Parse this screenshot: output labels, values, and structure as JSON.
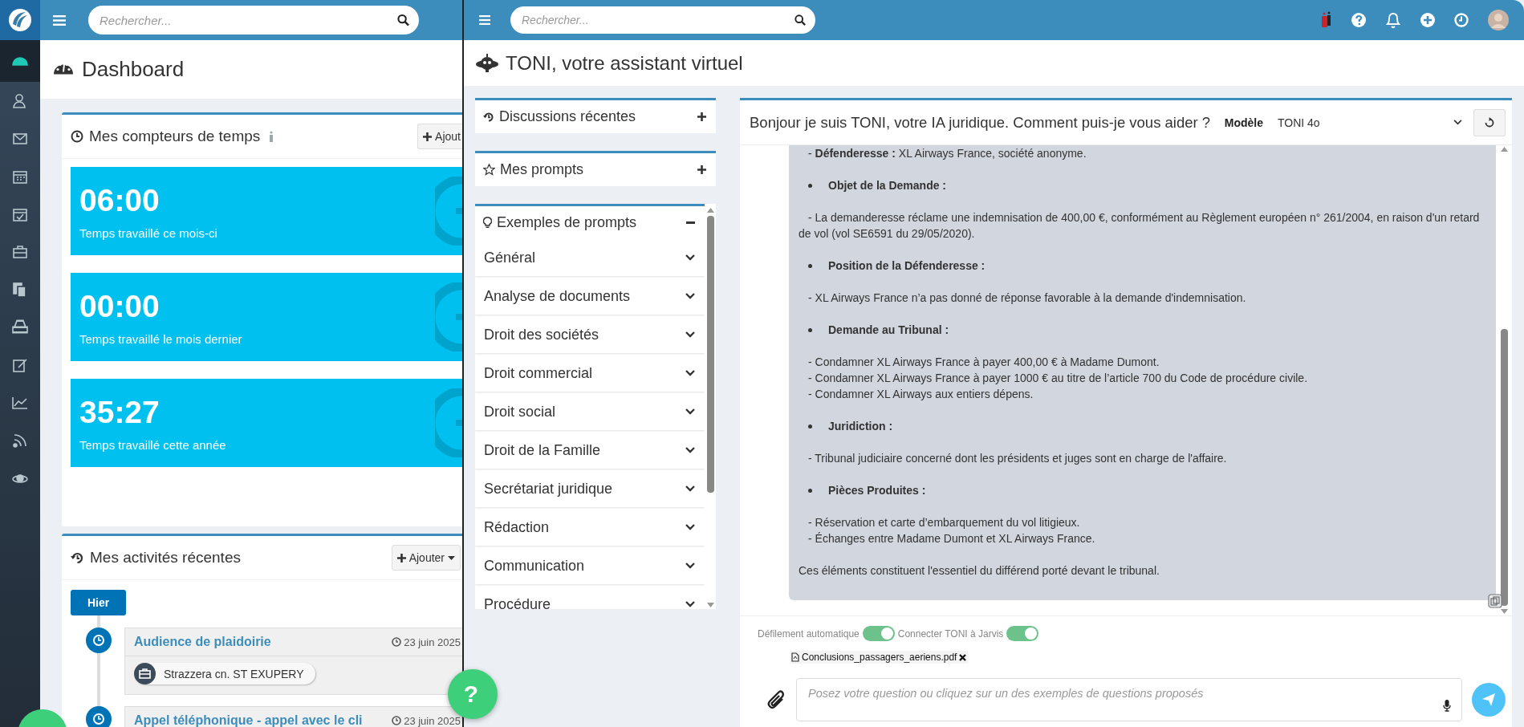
{
  "app_bar": {
    "search": {
      "placeholder": "Rechercher..."
    }
  },
  "sidebar": {
    "items": [
      {
        "selected": true
      },
      {
        "selected": false
      },
      {
        "selected": false
      },
      {
        "selected": false
      },
      {
        "selected": false
      },
      {
        "selected": false
      },
      {
        "selected": false
      },
      {
        "selected": false
      },
      {
        "selected": false
      },
      {
        "selected": false
      },
      {
        "selected": false
      },
      {
        "selected": false
      }
    ]
  },
  "dashboard": {
    "title": "Dashboard",
    "counters_card": {
      "title": "Mes compteurs de temps",
      "add_button": "Ajout",
      "counters": [
        {
          "value": "06:00",
          "label": "Temps travaillé ce mois-ci"
        },
        {
          "value": "00:00",
          "label": "Temps travaillé le mois dernier"
        },
        {
          "value": "35:27",
          "label": "Temps travaillé cette année"
        }
      ]
    },
    "activities_card": {
      "title": "Mes activités récentes",
      "add_button": "Ajouter",
      "groups": [
        {
          "label": "Hier",
          "items": [
            {
              "title": "Audience de plaidoirie",
              "date": "23 juin 2025",
              "tags": [
                "Strazzera cn. ST EXUPERY"
              ]
            },
            {
              "title": "Appel téléphonique - appel avec le cli",
              "date": "23 juin 2025"
            }
          ]
        }
      ]
    }
  },
  "help_button": {
    "label": "?"
  },
  "assistant": {
    "top_bar": {
      "search": {
        "placeholder": "Rechercher..."
      }
    },
    "title": "TONI, votre assistant virtuel",
    "sections": [
      {
        "title": "Discussions récentes",
        "expanded": false
      },
      {
        "title": "Mes prompts",
        "expanded": false
      },
      {
        "title": "Exemples de prompts",
        "expanded": true,
        "items": [
          "Général",
          "Analyse de documents",
          "Droit des sociétés",
          "Droit commercial",
          "Droit social",
          "Droit de la Famille",
          "Secrétariat juridique",
          "Rédaction",
          "Communication",
          "Procédure"
        ]
      }
    ],
    "chat": {
      "greeting": "Bonjour je suis TONI, votre IA juridique. Comment puis-je vous aider ?",
      "model_label": "Modèle",
      "model": "TONI 4o",
      "message": [
        {
          "kind": "text",
          "lines": [
            "- **Défenderesse :** XL Airways France, société anonyme."
          ]
        },
        {
          "kind": "bullet",
          "lines": [
            "Objet de la Demande :"
          ]
        },
        {
          "kind": "text",
          "lines": [
            "- La demanderesse réclame une indemnisation de 400,00 €, conformément au Règlement européen n° 261/2004, en raison d'un retard de vol (vol SE6591 du 29/05/2020)."
          ]
        },
        {
          "kind": "bullet",
          "lines": [
            "Position de la Défenderesse :"
          ]
        },
        {
          "kind": "text",
          "lines": [
            "- XL Airways France n’a pas donné de réponse favorable à la demande d'indemnisation."
          ]
        },
        {
          "kind": "bullet",
          "lines": [
            "Demande au Tribunal :"
          ]
        },
        {
          "kind": "text",
          "lines": [
            "- Condamner XL Airways France à payer 400,00 € à Madame Dumont.",
            "- Condamner XL Airways France à payer 1000 € au titre de l’article 700 du Code de procédure civile.",
            "- Condamner XL Airways aux entiers dépens."
          ]
        },
        {
          "kind": "bullet",
          "lines": [
            "Juridiction :"
          ]
        },
        {
          "kind": "text",
          "lines": [
            "- Tribunal judiciaire concerné dont les présidents et juges sont en charge de l'affaire."
          ]
        },
        {
          "kind": "bullet",
          "lines": [
            "Pièces Produites :"
          ]
        },
        {
          "kind": "text",
          "lines": [
            "- Réservation et carte d’embarquement du vol litigieux.",
            "- Échanges entre Madame Dumont et XL Airways France."
          ]
        },
        {
          "kind": "plain",
          "lines": [
            "Ces éléments constituent l'essentiel du différend porté devant le tribunal."
          ]
        }
      ],
      "toggles": [
        {
          "label": "Défilement automatique",
          "on": true
        },
        {
          "label": "Connecter TONI à Jarvis",
          "on": true
        }
      ],
      "attachment": "Conclusions_passagers_aeriens.pdf",
      "input": {
        "placeholder": "Posez votre question ou cliquez sur un des exemples de questions proposés"
      }
    }
  }
}
